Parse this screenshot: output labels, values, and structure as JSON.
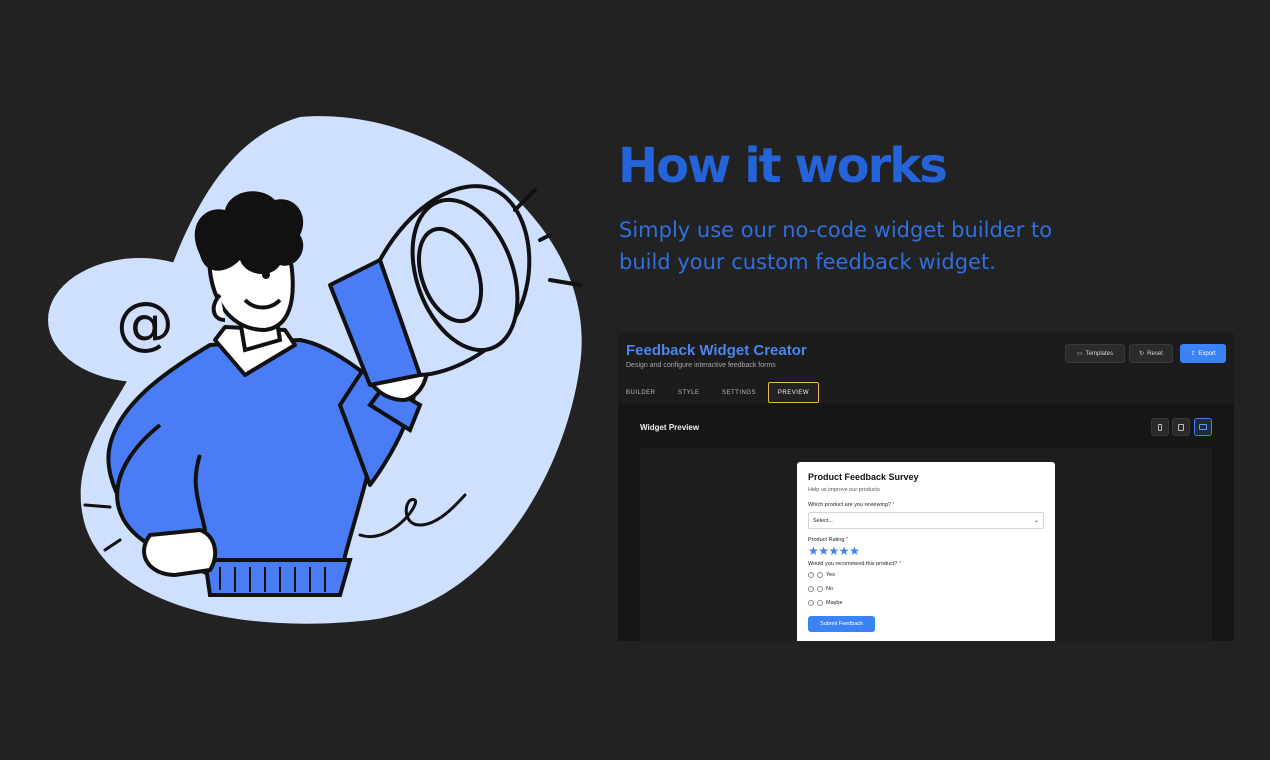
{
  "hero": {
    "title": "How it works",
    "subtitle": "Simply use our no-code widget builder to build your custom feedback widget."
  },
  "colors": {
    "background": "#222222",
    "accent": "#2563d8",
    "blob": "#cfe0ff",
    "sweater": "#4a7cf5"
  },
  "illustration": {
    "speech_bubble_symbol": "@"
  },
  "app": {
    "title": "Feedback Widget Creator",
    "subtitle": "Design and configure interactive feedback forms",
    "buttons": [
      {
        "label": "Templates",
        "icon": "template-icon"
      },
      {
        "label": "Reset",
        "icon": "refresh-icon"
      },
      {
        "label": "Export",
        "icon": "export-icon"
      }
    ],
    "tabs": [
      {
        "label": "BUILDER"
      },
      {
        "label": "STYLE"
      },
      {
        "label": "SETTINGS"
      },
      {
        "label": "PREVIEW",
        "active": true
      }
    ],
    "preview_label": "Widget Preview",
    "devices": [
      {
        "icon": "mobile-icon"
      },
      {
        "icon": "tablet-icon"
      },
      {
        "icon": "desktop-icon",
        "active": true
      }
    ],
    "widget": {
      "title": "Product Feedback Survey",
      "description": "Help us improve our products",
      "q1_label": "Which product are you reviewing?",
      "q1_required": "*",
      "q1_value": "Select...",
      "q2_label": "Product Rating",
      "q2_required": "*",
      "rating_max": 5,
      "q3_label": "Would you recommend this product?",
      "q3_required": "*",
      "options": [
        "Yes",
        "No",
        "Maybe"
      ],
      "submit_label": "Submit Feedback"
    }
  }
}
